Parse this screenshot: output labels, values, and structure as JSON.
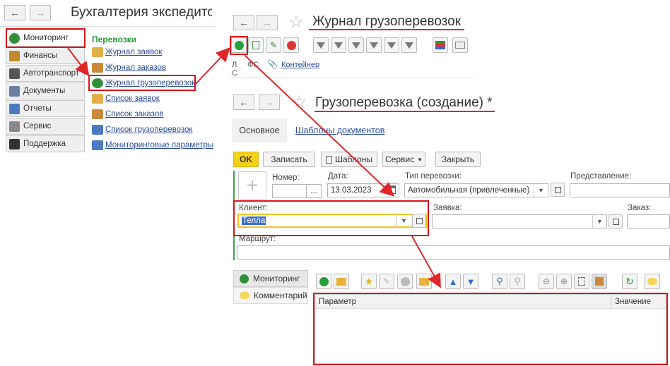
{
  "left_window": {
    "title": "Бухгалтерия экспедито",
    "sidebar": [
      {
        "label": "Мониторинг",
        "color": "#2f8f3a"
      },
      {
        "label": "Финансы",
        "color": "#c08a2a"
      },
      {
        "label": "Автотранспорт",
        "color": "#555"
      },
      {
        "label": "Документы",
        "color": "#6a7fa8"
      },
      {
        "label": "Отчеты",
        "color": "#4b79c2"
      },
      {
        "label": "Сервис",
        "color": "#888"
      },
      {
        "label": "Поддержка",
        "color": "#333"
      }
    ],
    "section_title": "Перевозки",
    "links": [
      {
        "label": "Журнал заявок"
      },
      {
        "label": "Журнал заказов"
      },
      {
        "label": "Журнал грузоперевозок"
      },
      {
        "label": "Список заявок"
      },
      {
        "label": "Список заказов"
      },
      {
        "label": "Список грузоперевозок"
      },
      {
        "label": "Мониторинговые параметры"
      }
    ]
  },
  "journal_window": {
    "title": "Журнал грузоперевозок",
    "columns": [
      "Л С",
      "ФС",
      "Контейнер"
    ]
  },
  "form_window": {
    "title": "Грузоперевозка (создание) *",
    "tabs": [
      "Основное",
      "Шаблоны документов"
    ],
    "buttons": {
      "ok": "OK",
      "save": "Записать",
      "templates": "Шаблоны",
      "service": "Сервис",
      "close": "Закрыть"
    },
    "fields": {
      "number_label": "Номер:",
      "number_value": "",
      "number_more": "...",
      "date_label": "Дата:",
      "date_value": "13.03.2023",
      "type_label": "Тип перевозки:",
      "type_value": "Автомобильная (привлеченные)",
      "repr_label": "Представление:",
      "repr_value": "",
      "client_label": "Клиент:",
      "client_value": "Телла",
      "request_label": "Заявка:",
      "request_value": "",
      "order_label": "Заказ:",
      "order_value": "",
      "route_label": "Маршрут:",
      "route_value": ""
    },
    "side_tabs": [
      "Мониторинг",
      "Комментарий"
    ],
    "table_columns": [
      "Параметр",
      "Значение"
    ]
  },
  "colors": {
    "accent_red": "#d9151b",
    "ok_yellow": "#f6d11a",
    "link_blue": "#2a4c9c",
    "section_green": "#2a9a3a"
  }
}
